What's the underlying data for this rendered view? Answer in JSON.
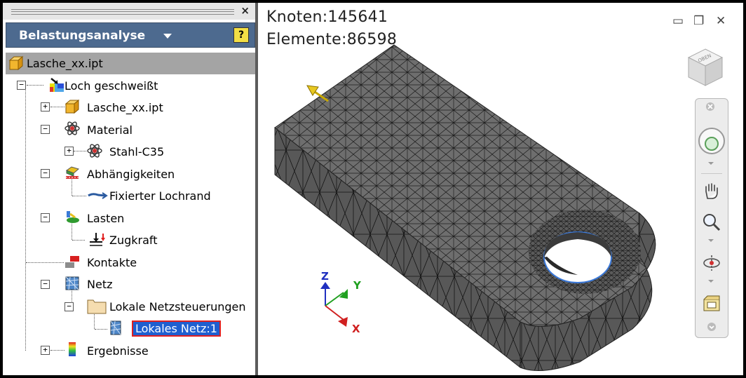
{
  "browser": {
    "title": "Belastungsanalyse",
    "help_icon": "?",
    "close_icon": "×",
    "root_file": "Lasche_xx.ipt",
    "items": [
      {
        "label": "Loch geschweißt"
      },
      {
        "label": "Lasche_xx.ipt"
      },
      {
        "label": "Material"
      },
      {
        "label": "Stahl-C35"
      },
      {
        "label": "Abhängigkeiten"
      },
      {
        "label": "Fixierter Lochrand"
      },
      {
        "label": "Lasten"
      },
      {
        "label": "Zugkraft"
      },
      {
        "label": "Kontakte"
      },
      {
        "label": "Netz"
      },
      {
        "label": "Lokale Netzsteuerungen"
      },
      {
        "label": "Lokales Netz:1"
      },
      {
        "label": "Ergebnisse"
      }
    ]
  },
  "viewport": {
    "nodes": "Knoten:145641",
    "elements": "Elemente:86598",
    "window_buttons": {
      "minimize": "▭",
      "restore": "❐",
      "close": "✕"
    },
    "viewcube_label": "OBEN",
    "triad": {
      "x": "X",
      "y": "Y",
      "z": "Z"
    }
  },
  "colors": {
    "header_bg": "#4d6a8f",
    "selection_bg": "#1f5fd0",
    "selection_outline": "#e02020",
    "mesh_dark": "#2a2a2a",
    "mesh_fill": "#6b6b6b",
    "hole_edge": "#3a78d8"
  },
  "icons": {
    "part": "part-cube-icon",
    "study": "stress-study-icon",
    "material": "material-atom-icon",
    "constraints": "constraints-icon",
    "loads": "loads-icon",
    "contacts": "contacts-icon",
    "mesh": "mesh-icon",
    "folder": "folder-icon",
    "results": "results-gradient-icon"
  }
}
